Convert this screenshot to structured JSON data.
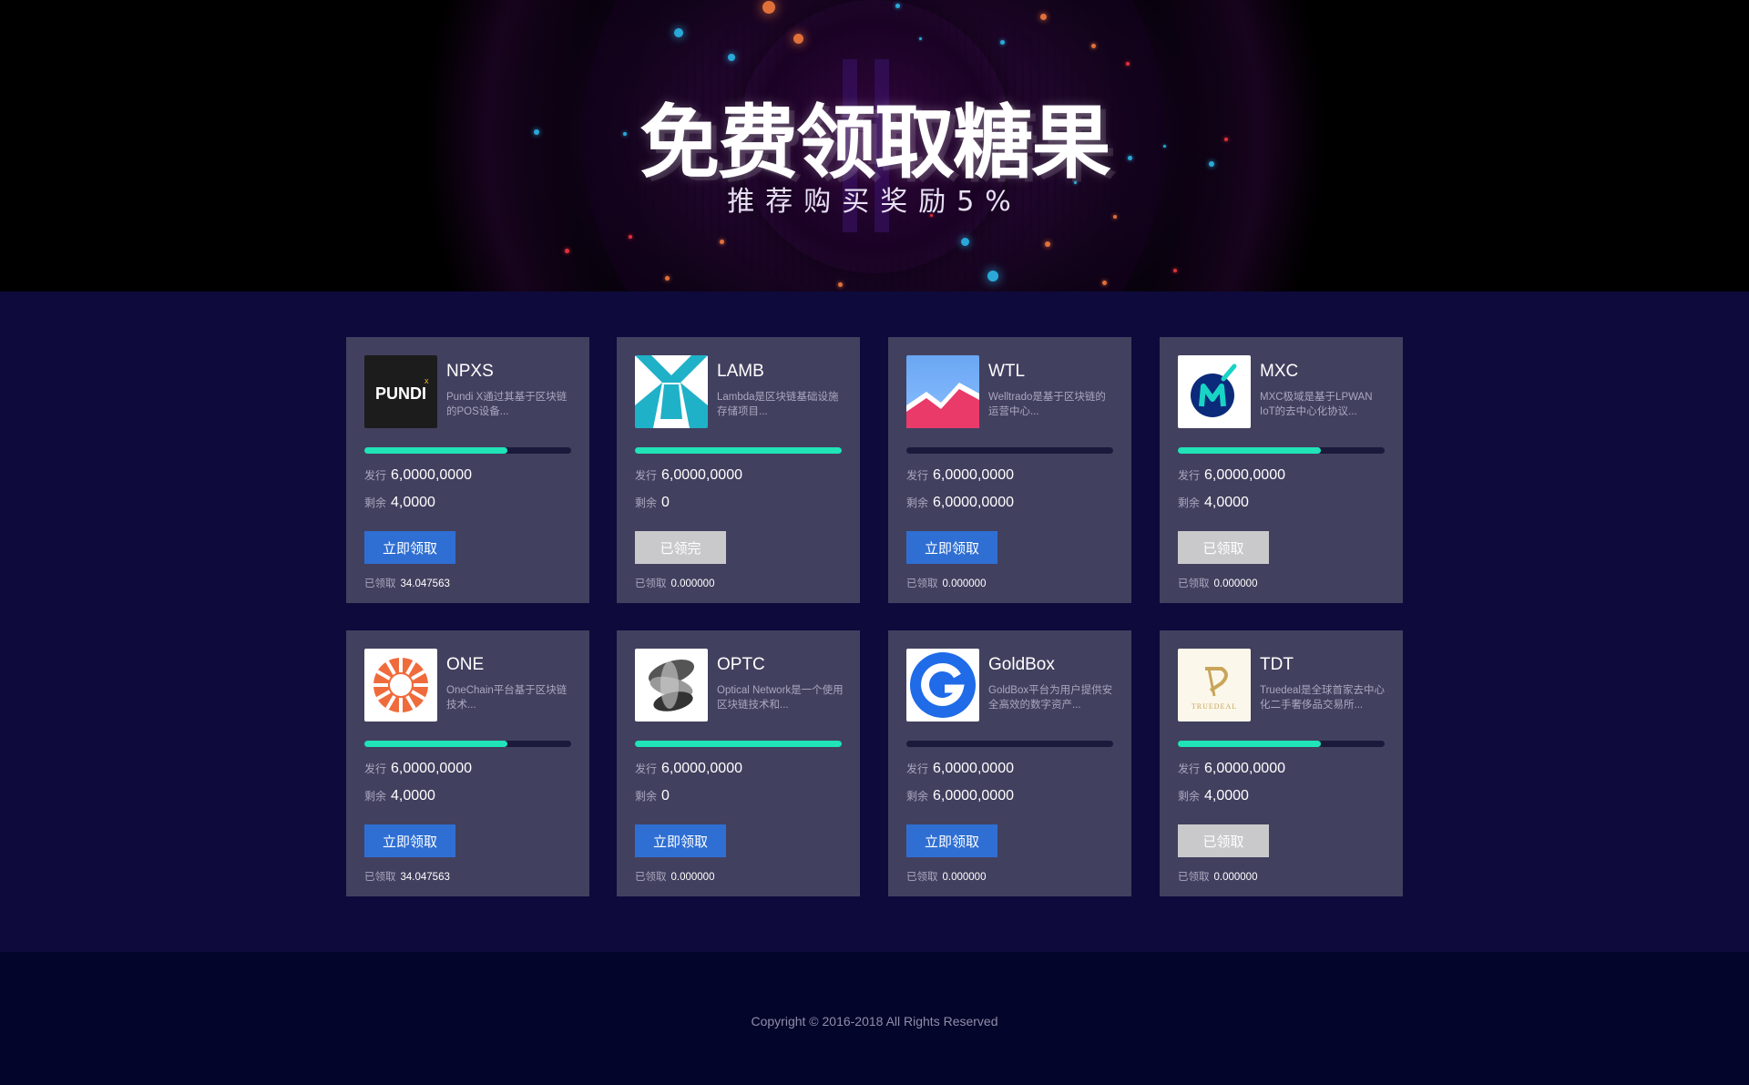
{
  "hero": {
    "title": "免费领取糖果",
    "subtitle": "推荐购买奖励5%"
  },
  "labels": {
    "issued": "发行",
    "remaining": "剩余",
    "claimed": "已领取"
  },
  "tokens": [
    {
      "name": "NPXS",
      "desc": "Pundi X通过其基于区块链的POS设备...",
      "issued": "6,0000,0000",
      "remaining": "4,0000",
      "progress": 0.69,
      "button": "立即领取",
      "button_state": "active",
      "claimed": "34.047563",
      "logo": "pundi-x-logo"
    },
    {
      "name": "LAMB",
      "desc": "Lambda是区块链基础设施存储项目...",
      "issued": "6,0000,0000",
      "remaining": "0",
      "progress": 1.0,
      "button": "已领完",
      "button_state": "disabled",
      "claimed": "0.000000",
      "logo": "lambda-logo"
    },
    {
      "name": "WTL",
      "desc": "Welltrado是基于区块链的运营中心...",
      "issued": "6,0000,0000",
      "remaining": "6,0000,0000",
      "progress": 0.0,
      "button": "立即领取",
      "button_state": "active",
      "claimed": "0.000000",
      "logo": "welltrado-logo"
    },
    {
      "name": "MXC",
      "desc": "MXC极域是基于LPWAN IoT的去中心化协议...",
      "issued": "6,0000,0000",
      "remaining": "4,0000",
      "progress": 0.69,
      "button": "已领取",
      "button_state": "disabled",
      "claimed": "0.000000",
      "logo": "mxc-logo"
    },
    {
      "name": "ONE",
      "desc": "OneChain平台基于区块链技术...",
      "issued": "6,0000,0000",
      "remaining": "4,0000",
      "progress": 0.69,
      "button": "立即领取",
      "button_state": "active",
      "claimed": "34.047563",
      "logo": "onechain-logo"
    },
    {
      "name": "OPTC",
      "desc": "Optical Network是一个使用区块链技术和...",
      "issued": "6,0000,0000",
      "remaining": "0",
      "progress": 1.0,
      "button": "立即领取",
      "button_state": "active",
      "claimed": "0.000000",
      "logo": "optical-network-logo"
    },
    {
      "name": "GoldBox",
      "desc": "GoldBox平台为用户提供安全高效的数字资产...",
      "issued": "6,0000,0000",
      "remaining": "6,0000,0000",
      "progress": 0.0,
      "button": "立即领取",
      "button_state": "active",
      "claimed": "0.000000",
      "logo": "goldbox-logo"
    },
    {
      "name": "TDT",
      "desc": "Truedeal是全球首家去中心化二手奢侈品交易所...",
      "issued": "6,0000,0000",
      "remaining": "4,0000",
      "progress": 0.69,
      "button": "已领取",
      "button_state": "disabled",
      "claimed": "0.000000",
      "logo": "truedeal-logo",
      "logo_text": "TRUEDEAL"
    }
  ],
  "footer": {
    "copyright": "Copyright © 2016-2018 All Rights Reserved"
  }
}
